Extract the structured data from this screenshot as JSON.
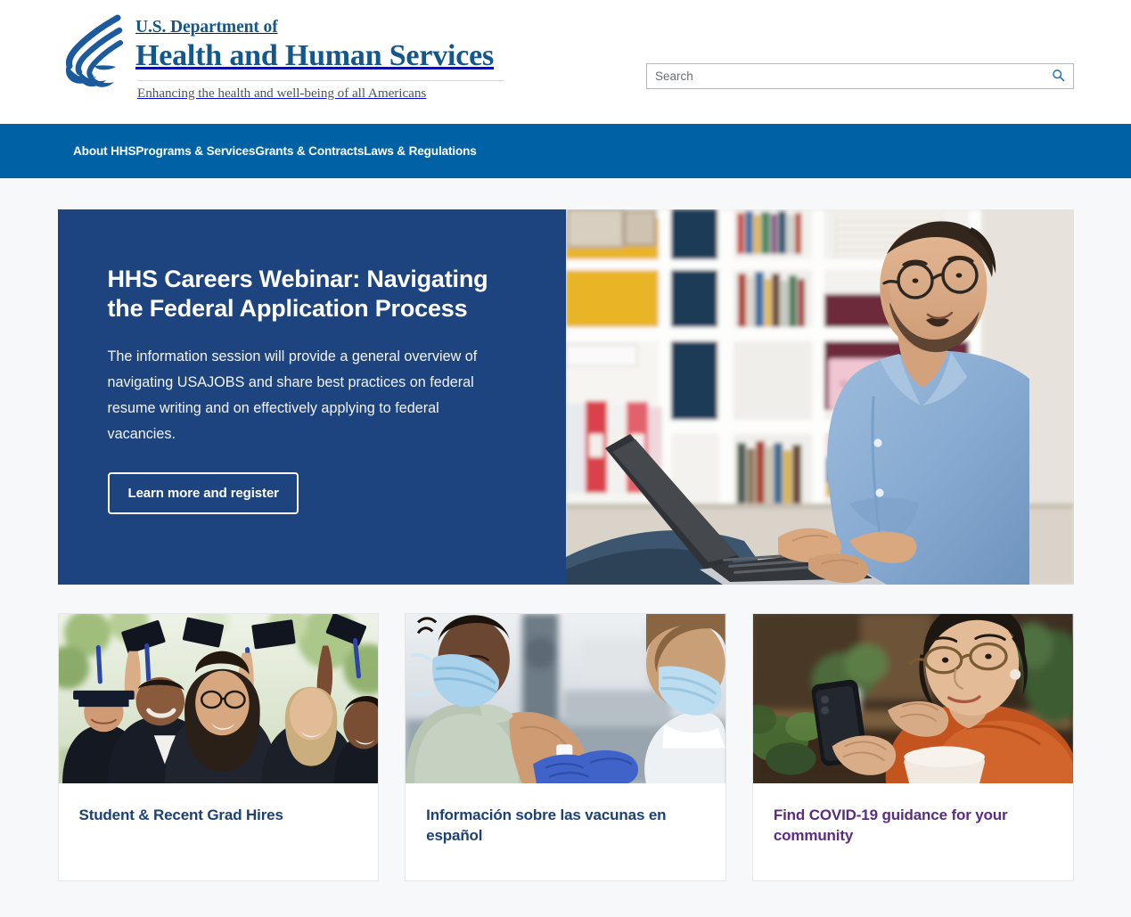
{
  "header": {
    "logo_icon": "hhs-eagle-logo",
    "agency_line1": "U.S. Department of",
    "agency_line2": "Health and Human Services",
    "tagline": "Enhancing the health and well-being of all Americans",
    "brand_color": "#14578b"
  },
  "search": {
    "placeholder": "Search",
    "value": "",
    "icon": "search-icon",
    "icon_color": "#1b6ca8"
  },
  "nav": {
    "background": "#0062a5",
    "items": [
      {
        "label": "About HHS"
      },
      {
        "label": "Programs & Services"
      },
      {
        "label": "Grants & Contracts"
      },
      {
        "label": "Laws & Regulations"
      }
    ]
  },
  "hero": {
    "background": "#1e4480",
    "title": "HHS Careers Webinar: Navigating the Federal Application Process",
    "description": "The information session will provide a general overview of navigating USAJOBS and share best practices on federal resume writing and on effectively applying to federal vacancies.",
    "button_label": "Learn more and register",
    "image_alt": "Man with glasses in a blue shirt sitting on the floor using a laptop in front of a white bookshelf"
  },
  "cards": [
    {
      "title": "Student & Recent Grad Hires",
      "title_color": "#1b4175",
      "visited": false,
      "image_alt": "Group of smiling graduates in caps and gowns throwing their caps in the air"
    },
    {
      "title": "Información sobre las vacunas en español",
      "title_color": "#1b4175",
      "visited": false,
      "image_alt": "Person in a mask receiving a vaccination in the arm from a gloved health worker"
    },
    {
      "title": "Find COVID-19 guidance for your community",
      "title_color": "#5a2d82",
      "visited": true,
      "image_alt": "Woman in an orange top with glasses looking at a smartphone"
    }
  ]
}
